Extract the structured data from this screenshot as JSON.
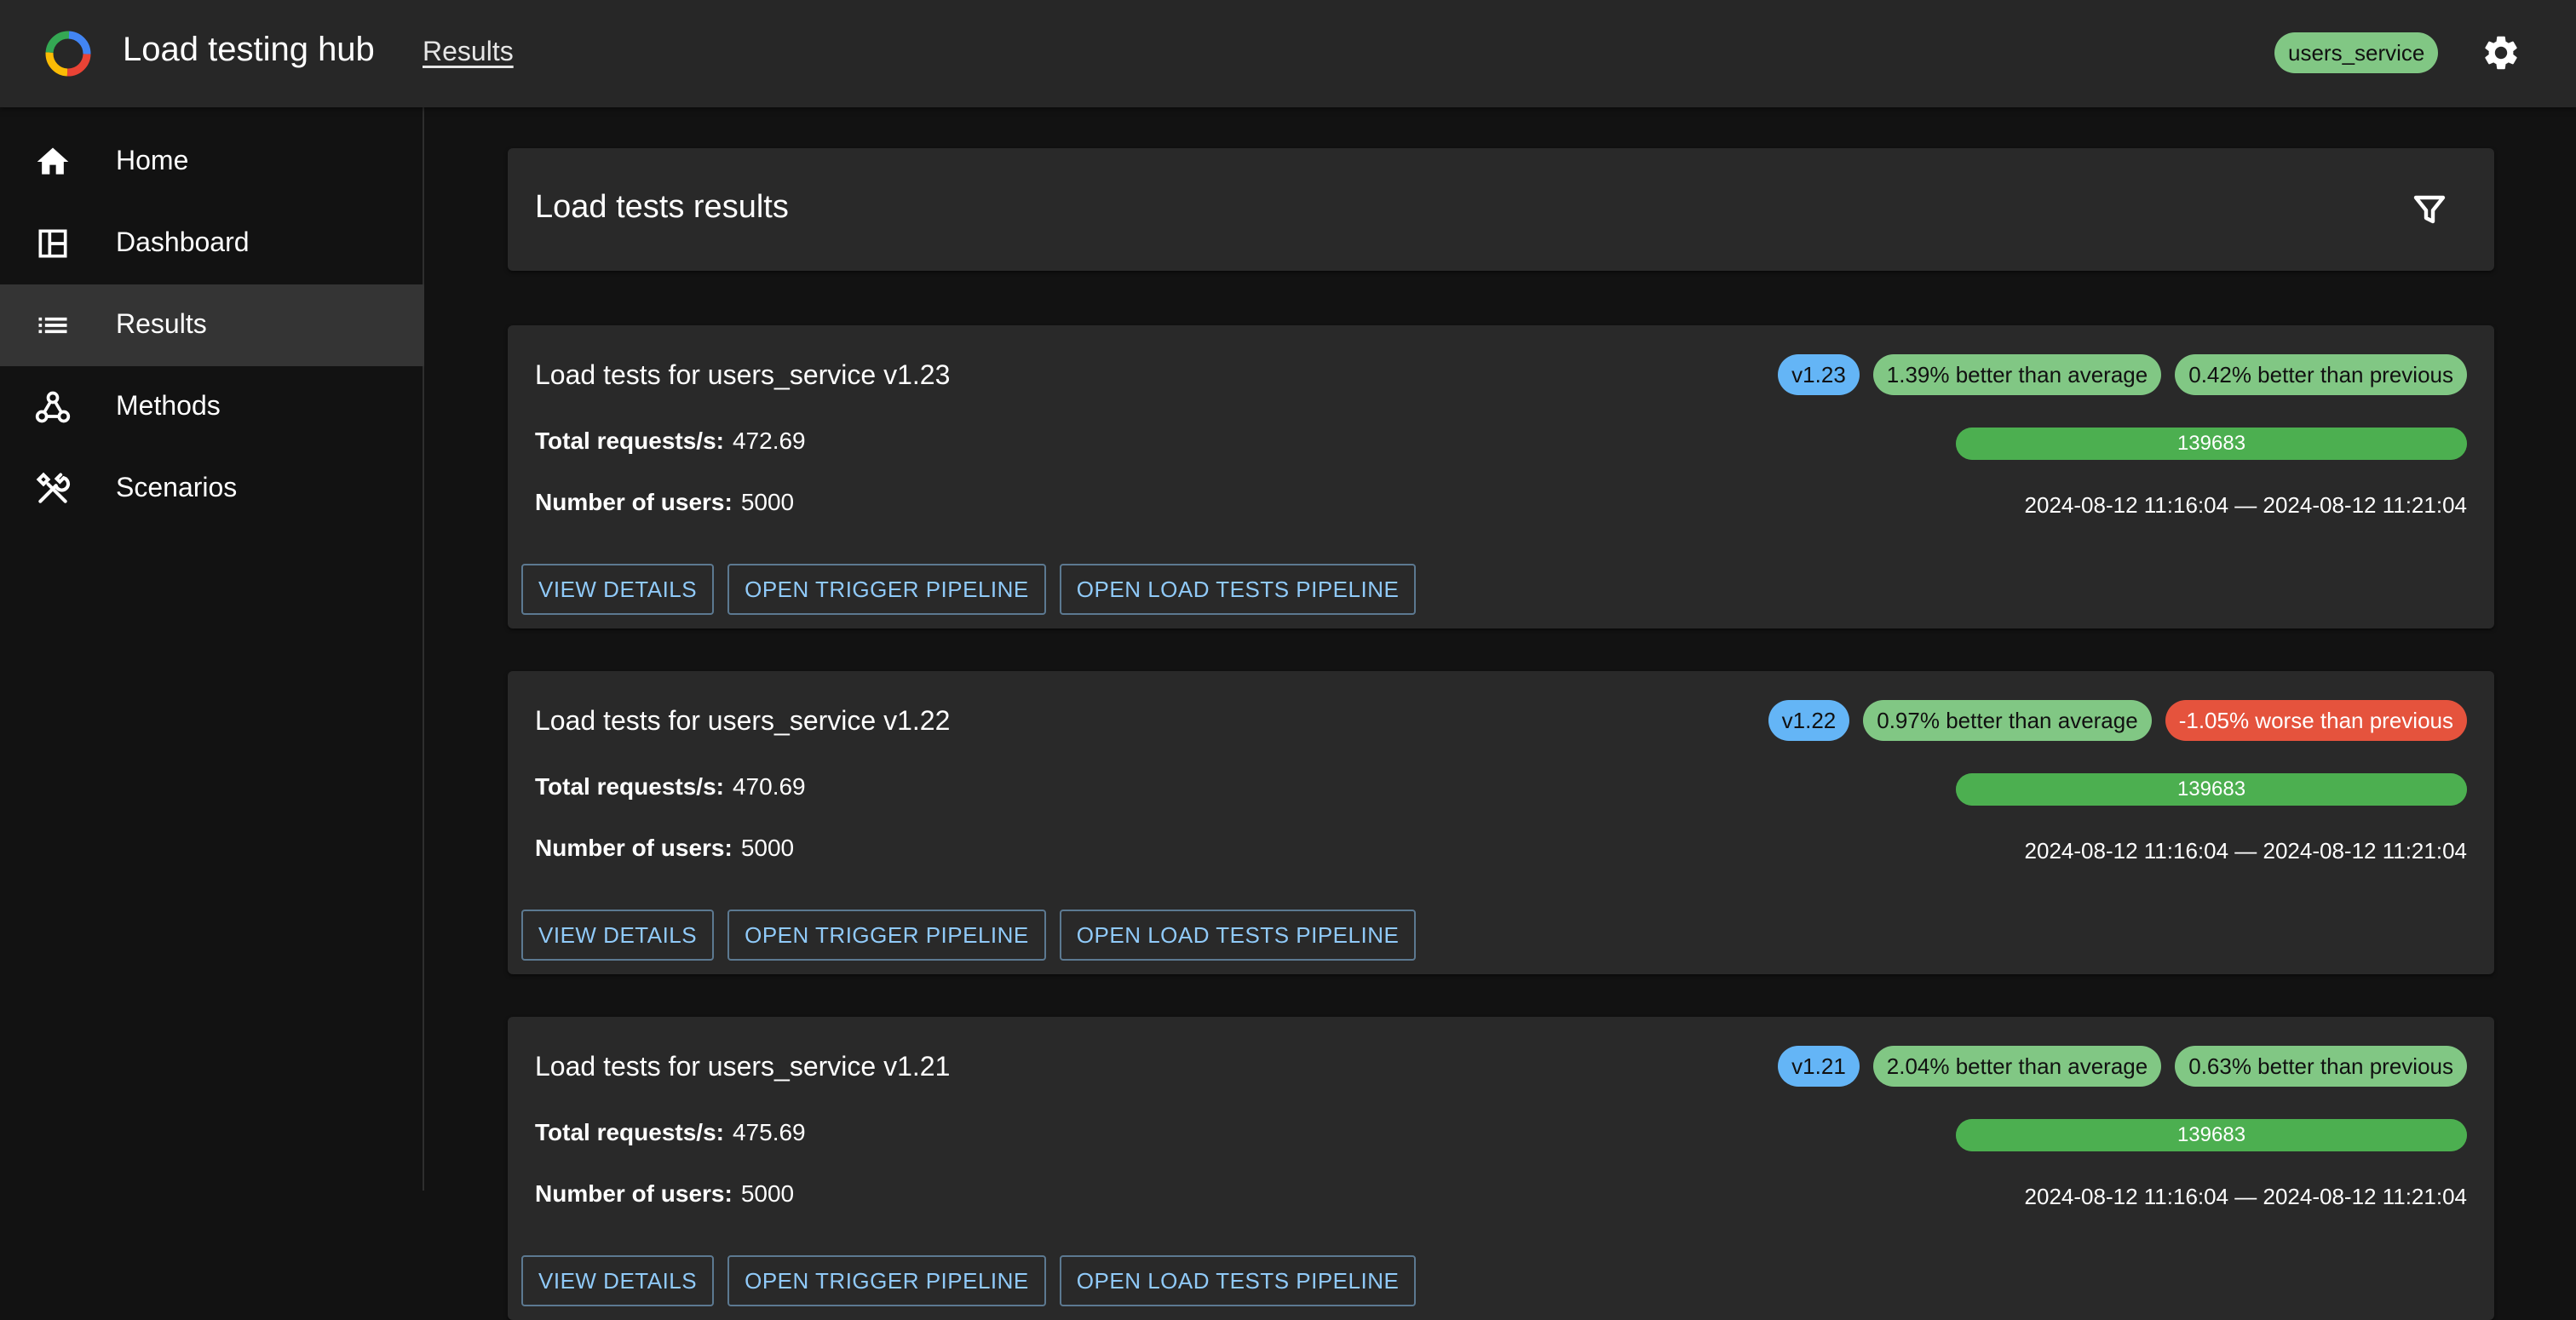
{
  "topbar": {
    "title": "Load testing hub",
    "breadcrumb": "Results",
    "service_chip": "users_service",
    "colors": {
      "accent": "#81c784",
      "background": "#272727"
    }
  },
  "sidebar": {
    "items": [
      {
        "label": "Home",
        "icon": "home-icon"
      },
      {
        "label": "Dashboard",
        "icon": "dashboard-icon"
      },
      {
        "label": "Results",
        "icon": "list-icon",
        "active": true
      },
      {
        "label": "Methods",
        "icon": "webhook-icon"
      },
      {
        "label": "Scenarios",
        "icon": "tools-icon"
      }
    ]
  },
  "main": {
    "header": {
      "title": "Load tests results",
      "filter_icon": "filter-icon"
    },
    "labels": {
      "total_requests": "Total requests/s:",
      "number_of_users": "Number of users:",
      "view_details": "VIEW DETAILS",
      "open_trigger": "OPEN TRIGGER PIPELINE",
      "open_load": "OPEN LOAD TESTS PIPELINE"
    },
    "cards": [
      {
        "title": "Load tests for users_service v1.23",
        "version": "v1.23",
        "avg": "1.39% better than average",
        "prev": "0.42% better than previous",
        "prev_color": "#81c784",
        "total_rps": "472.69",
        "users": "5000",
        "requests": "139683",
        "requests_progress": 1.0,
        "period": "2024-08-12 11:16:04 — 2024-08-12 11:21:04"
      },
      {
        "title": "Load tests for users_service v1.22",
        "version": "v1.22",
        "avg": "0.97% better than average",
        "prev": "-1.05% worse than previous",
        "prev_color": "#e5533d",
        "total_rps": "470.69",
        "users": "5000",
        "requests": "139683",
        "requests_progress": 1.0,
        "period": "2024-08-12 11:16:04 — 2024-08-12 11:21:04"
      },
      {
        "title": "Load tests for users_service v1.21",
        "version": "v1.21",
        "avg": "2.04% better than average",
        "prev": "0.63% better than previous",
        "prev_color": "#81c784",
        "total_rps": "475.69",
        "users": "5000",
        "requests": "139683",
        "requests_progress": 1.0,
        "period": "2024-08-12 11:16:04 — 2024-08-12 11:21:04"
      }
    ]
  }
}
